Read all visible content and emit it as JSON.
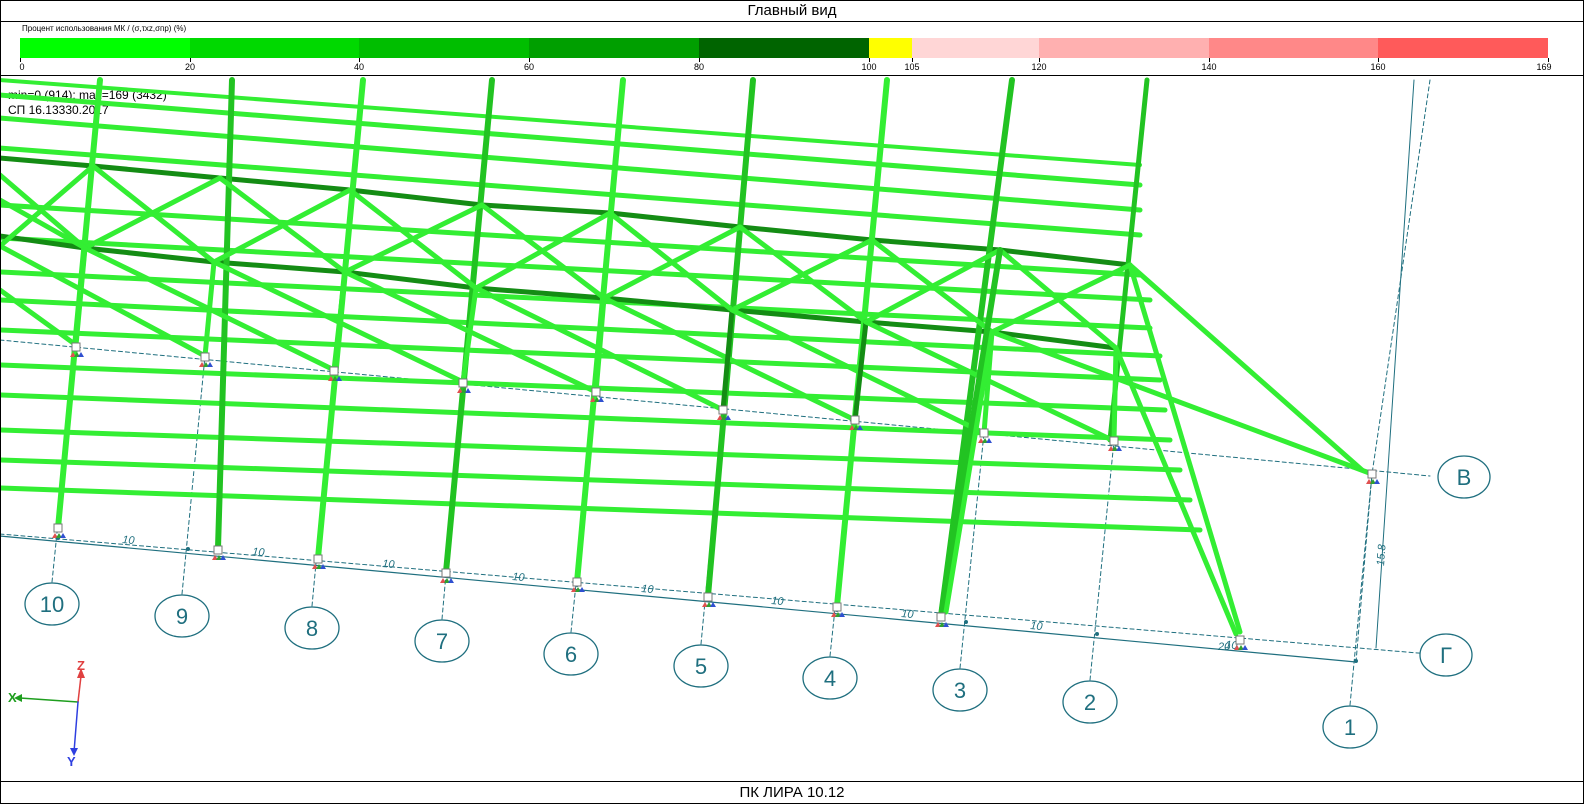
{
  "window": {
    "title": "Главный вид"
  },
  "legend": {
    "title": "Процент использования МК / (σ,τxz,σпр) (%)",
    "segments": [
      {
        "from": 0,
        "to": 20,
        "color": "#00FF00"
      },
      {
        "from": 20,
        "to": 40,
        "color": "#00D900"
      },
      {
        "from": 40,
        "to": 60,
        "color": "#00BE00"
      },
      {
        "from": 60,
        "to": 80,
        "color": "#009F00"
      },
      {
        "from": 80,
        "to": 100,
        "color": "#006400"
      },
      {
        "from": 100,
        "to": 105,
        "color": "#FFFF00"
      },
      {
        "from": 105,
        "to": 120,
        "color": "#FFD6D6"
      },
      {
        "from": 120,
        "to": 140,
        "color": "#FFB0B0"
      },
      {
        "from": 140,
        "to": 160,
        "color": "#FF8888"
      },
      {
        "from": 160,
        "to": 169,
        "color": "#FF5A5A"
      }
    ],
    "ticks": [
      "0",
      "20",
      "40",
      "60",
      "80",
      "100",
      "105",
      "120",
      "140",
      "160",
      "169"
    ]
  },
  "info": {
    "range": "min=0 (914); max=169 (3432)",
    "code": "СП 16.13330.2017"
  },
  "axes": {
    "row_labels": [
      "В",
      "Г"
    ],
    "column_labels": [
      "10",
      "9",
      "8",
      "7",
      "6",
      "5",
      "4",
      "3",
      "2",
      "1"
    ]
  },
  "dimensions": {
    "spans": [
      "10",
      "10",
      "10",
      "10",
      "10",
      "10",
      "10",
      "10",
      "10",
      "20"
    ],
    "vertical": "15.8"
  },
  "triad": {
    "x": "X",
    "y": "Y",
    "z": "Z",
    "x_color": "#1E9E1E",
    "y_color": "#2E3FE0",
    "z_color": "#E04040"
  },
  "status": {
    "text": "ПК ЛИРА 10.12"
  },
  "colors": {
    "member_light": "#33EE33",
    "member_mid": "#22C322",
    "member_dark": "#148C14",
    "grid": "#1F6F7F",
    "bubble_text": "#1F6F7F"
  }
}
